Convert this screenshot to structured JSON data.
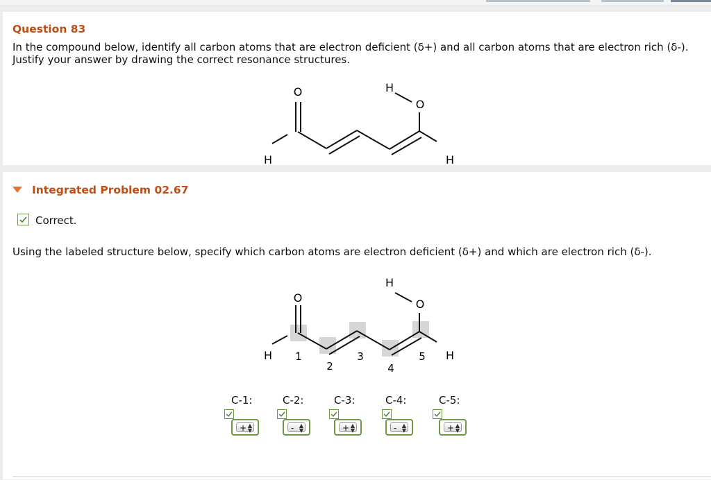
{
  "question": {
    "title": "Question 83",
    "text": "In the compound below, identify all carbon atoms that are electron deficient (δ+) and all carbon atoms that are electron rich (δ-). Justify your answer by drawing the correct resonance structures."
  },
  "molecule": {
    "atoms": [
      "O",
      "H",
      "O",
      "H",
      "H"
    ]
  },
  "problem": {
    "title": "Integrated Problem 02.67",
    "status": "Correct.",
    "text": "Using the labeled structure below, specify which carbon atoms are electron deficient (δ+) and which are electron rich (δ-).",
    "carbon_numbers": [
      "1",
      "2",
      "3",
      "4",
      "5"
    ]
  },
  "answers": [
    {
      "label": "C-1:",
      "value": "+"
    },
    {
      "label": "C-2:",
      "value": "-"
    },
    {
      "label": "C-3:",
      "value": "+"
    },
    {
      "label": "C-4:",
      "value": "-"
    },
    {
      "label": "C-5:",
      "value": "+"
    }
  ],
  "colors": {
    "title": "#c04d14",
    "correct_green": "#6a9a44",
    "triangle": "#e4742b",
    "highlight": "#d6d6d6"
  }
}
